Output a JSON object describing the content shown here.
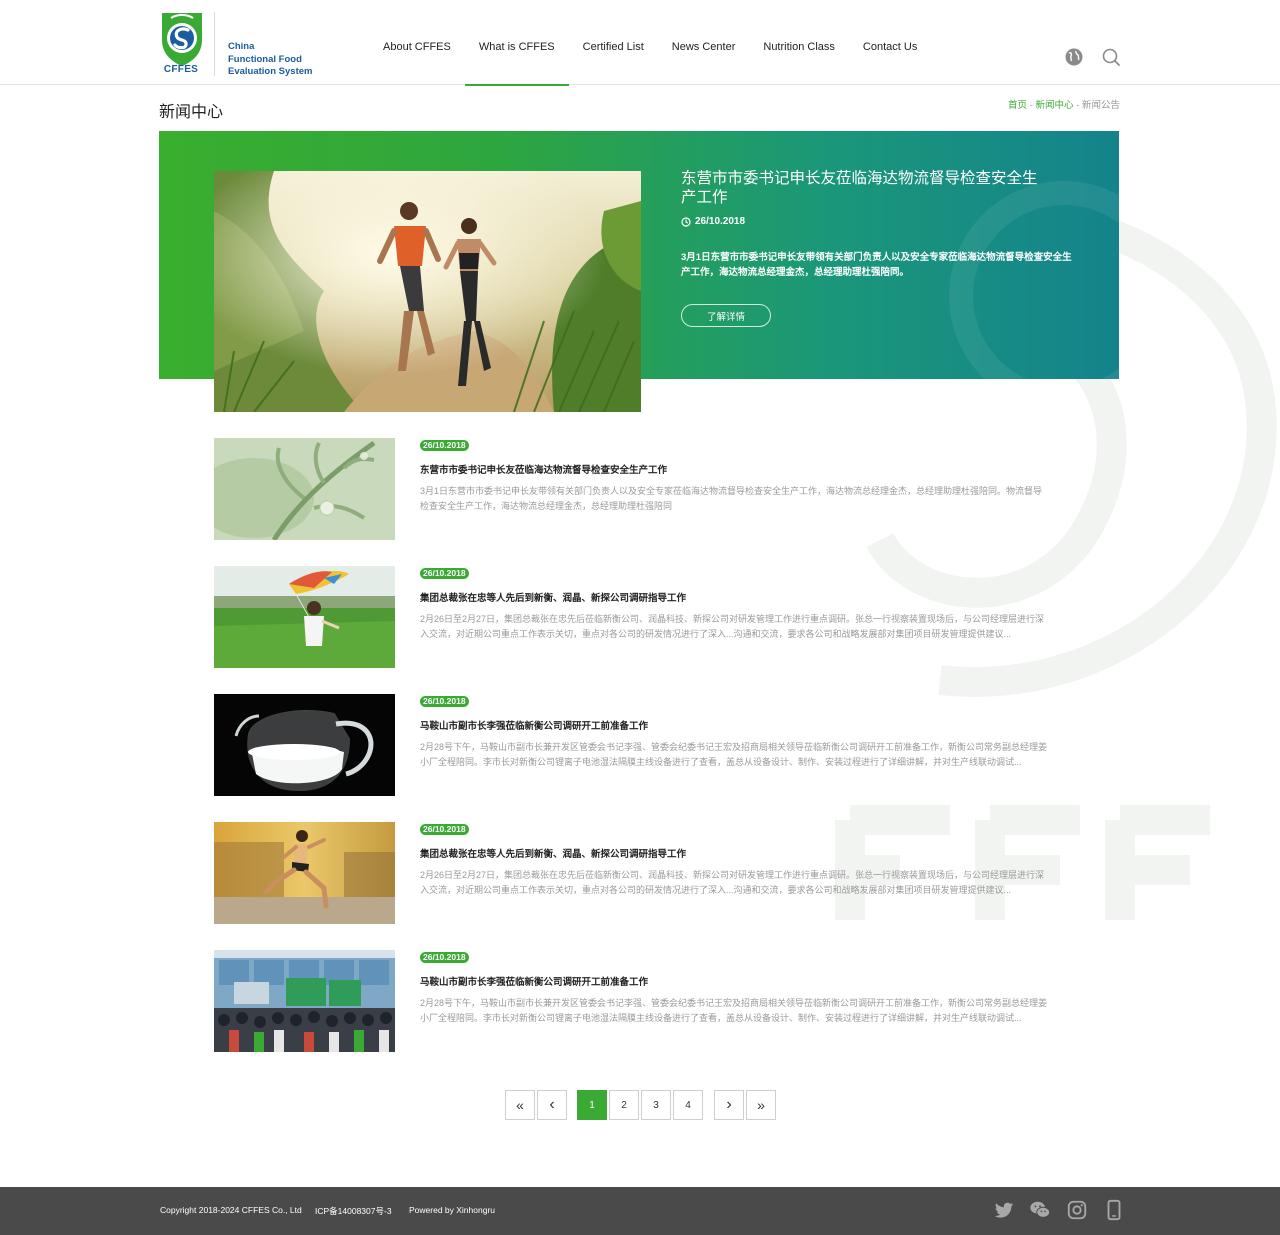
{
  "brand": {
    "logo_caption": "CFFES",
    "name_lines": [
      "China",
      "Functional Food",
      "Evaluation System"
    ]
  },
  "nav": {
    "items": [
      {
        "label": "About CFFES"
      },
      {
        "label": "What is CFFES"
      },
      {
        "label": "Certified List"
      },
      {
        "label": "News Center"
      },
      {
        "label": "Nutrition Class"
      },
      {
        "label": "Contact Us"
      }
    ],
    "active_index": 1
  },
  "page": {
    "title": "新闻中心",
    "breadcrumb": {
      "home": "首页",
      "sep1": " - ",
      "section": "新闻中心",
      "sep2": " - ",
      "current": "新闻公告"
    }
  },
  "featured": {
    "title": "东营市市委书记申长友莅临海达物流督导检查安全生产工作",
    "date": "26/10.2018",
    "description": "3月1日东营市市委书记申长友带领有关部门负责人以及安全专家莅临海达物流督导检查安全生产工作，海达物流总经理金杰，总经理助理杜强陪同。",
    "button_label": "了解详情"
  },
  "news": [
    {
      "date": "26/10.2018",
      "title": "东营市市委书记申长友莅临海达物流督导检查安全生产工作",
      "desc": "3月1日东营市市委书记申长友带领有关部门负责人以及安全专家莅临海达物流督导检查安全生产工作，海达物流总经理金杰，总经理助理杜强陪同。物流督导检查安全生产工作，海达物流总经理金杰，总经理助理杜强陪同"
    },
    {
      "date": "26/10.2018",
      "title": "集团总裁张在忠等人先后到新衡、润晶、新探公司调研指导工作",
      "desc": "2月26日至2月27日，集团总裁张在忠先后莅临新衡公司、润晶科技、新探公司对研发管理工作进行重点调研。张总一行视察装置现场后，与公司经理层进行深入交流，对近期公司重点工作表示关切，重点对各公司的研发情况进行了深入...沟通和交流，要求各公司和战略发展部对集团项目研发管理提供建议..."
    },
    {
      "date": "26/10.2018",
      "title": "马鞍山市副市长李强莅临新衡公司调研开工前准备工作",
      "desc": "2月28号下午，马鞍山市副市长兼开发区管委会书记李强、管委会纪委书记王宏及招商局相关领导莅临新衡公司调研开工前准备工作，新衡公司常务副总经理姜小厂全程陪同。李市长对新衡公司锂离子电池湿法隔膜主线设备进行了查看，盖总从设备设计、制作、安装过程进行了详细讲解，并对生产线联动调试..."
    },
    {
      "date": "26/10.2018",
      "title": "集团总裁张在忠等人先后到新衡、润晶、新探公司调研指导工作",
      "desc": "2月26日至2月27日，集团总裁张在忠先后莅临新衡公司、润晶科技、新探公司对研发管理工作进行重点调研。张总一行视察装置现场后，与公司经理层进行深入交流，对近期公司重点工作表示关切，重点对各公司的研发情况进行了深入...沟通和交流，要求各公司和战略发展部对集团项目研发管理提供建议..."
    },
    {
      "date": "26/10.2018",
      "title": "马鞍山市副市长李强莅临新衡公司调研开工前准备工作",
      "desc": "2月28号下午，马鞍山市副市长兼开发区管委会书记李强、管委会纪委书记王宏及招商局相关领导莅临新衡公司调研开工前准备工作，新衡公司常务副总经理姜小厂全程陪同。李市长对新衡公司锂离子电池湿法隔膜主线设备进行了查看，盖总从设备设计、制作、安装过程进行了详细讲解，并对生产线联动调试..."
    }
  ],
  "pagination": {
    "first": "«",
    "prev": "‹",
    "pages": [
      "1",
      "2",
      "3",
      "4"
    ],
    "active": "1",
    "next": "›",
    "last": "»"
  },
  "footer": {
    "copyright": "Copyright 2018-2024 CFFES Co., Ltd",
    "icp": "ICP备14008307号-3",
    "powered": "Powered by Xinhongru",
    "social_icons": [
      "twitter-icon",
      "wechat-icon",
      "instagram-icon",
      "mobile-icon"
    ]
  },
  "colors": {
    "accent": "#3aaa35",
    "brand_blue": "#1d5c9e",
    "footer_bg": "#4a4a4a",
    "band_end": "#14838c"
  }
}
